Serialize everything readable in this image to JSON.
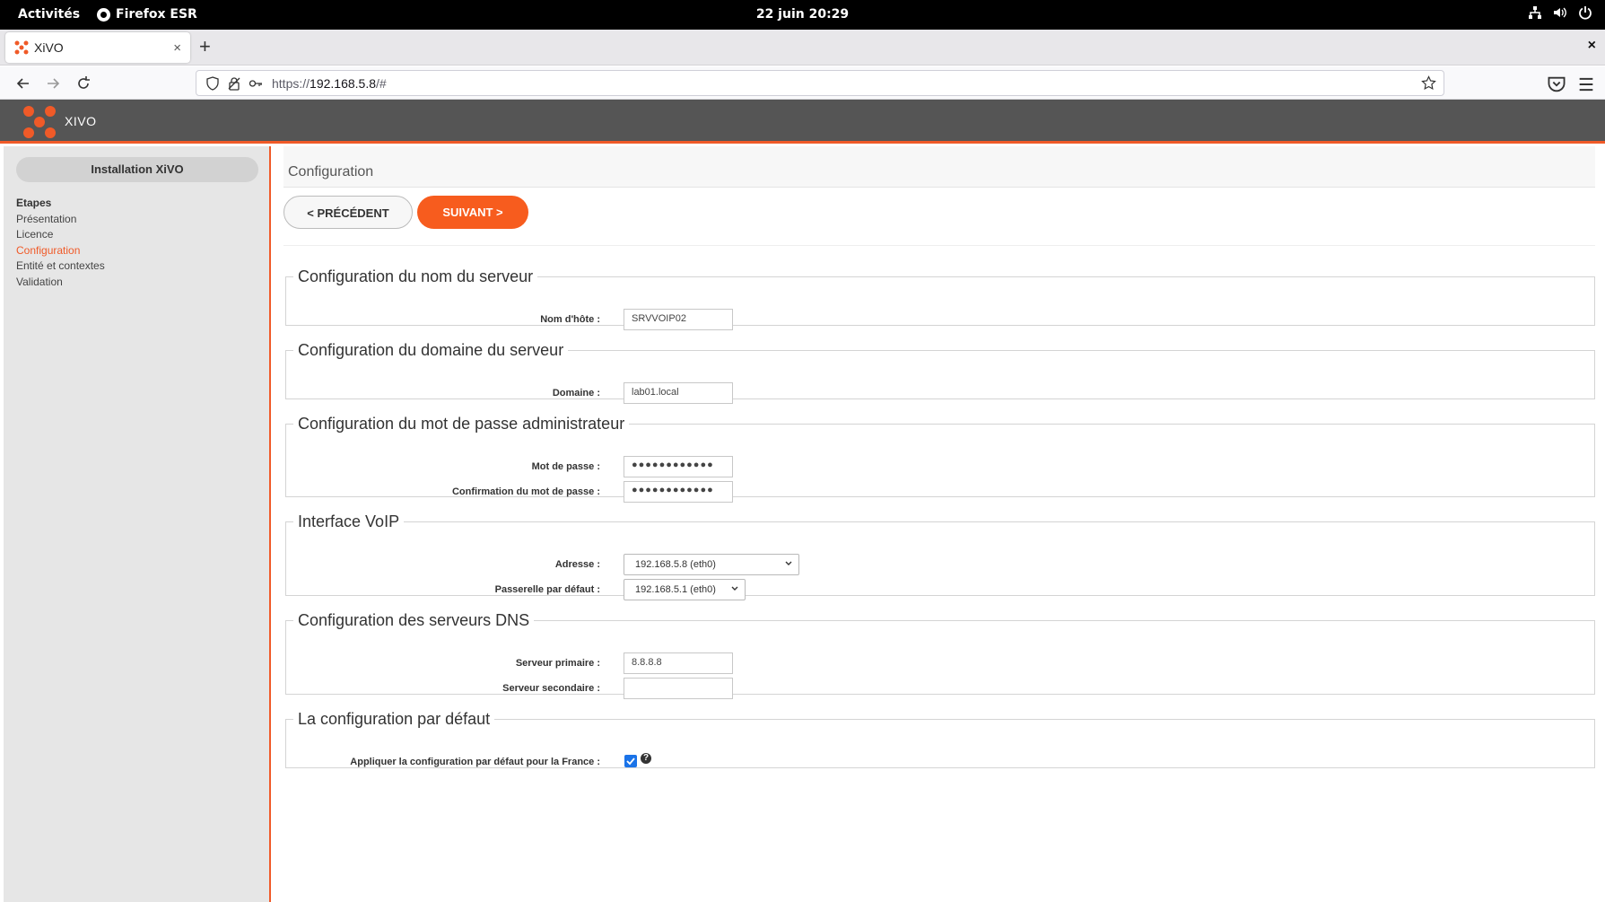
{
  "topbar": {
    "activities": "Activités",
    "app_name": "Firefox ESR",
    "clock": "22 juin  20:29"
  },
  "browser": {
    "tab_title": "XiVO",
    "tab_close": "×",
    "new_tab": "+",
    "window_close": "×",
    "url_prefix": "https://",
    "url_host": "192.168.5.8",
    "url_path": "/#"
  },
  "header": {
    "logo_text": "XIVO"
  },
  "sidebar": {
    "install_label": "Installation XiVO",
    "steps_title": "Etapes",
    "steps": [
      {
        "label": "Présentation",
        "active": false
      },
      {
        "label": "Licence",
        "active": false
      },
      {
        "label": "Configuration",
        "active": true
      },
      {
        "label": "Entité et contextes",
        "active": false
      },
      {
        "label": "Validation",
        "active": false
      }
    ]
  },
  "main": {
    "page_title": "Configuration",
    "prev_label": "< PRÉCÉDENT",
    "next_label": "SUIVANT >"
  },
  "sections": {
    "hostname": {
      "legend": "Configuration du nom du serveur",
      "label": "Nom d'hôte :",
      "value": "SRVVOIP02"
    },
    "domain": {
      "legend": "Configuration du domaine du serveur",
      "label": "Domaine :",
      "value": "lab01.local"
    },
    "password": {
      "legend": "Configuration du mot de passe administrateur",
      "pwd_label": "Mot de passe :",
      "pwd_value": "●●●●●●●●●●●●",
      "confirm_label": "Confirmation du mot de passe :",
      "confirm_value": "●●●●●●●●●●●●"
    },
    "voip": {
      "legend": "Interface VoIP",
      "address_label": "Adresse :",
      "address_value": "192.168.5.8 (eth0)",
      "gateway_label": "Passerelle par défaut :",
      "gateway_value": "192.168.5.1 (eth0)"
    },
    "dns": {
      "legend": "Configuration des serveurs DNS",
      "primary_label": "Serveur primaire :",
      "primary_value": "8.8.8.8",
      "secondary_label": "Serveur secondaire :",
      "secondary_value": ""
    },
    "defaults": {
      "legend": "La configuration par défaut",
      "label": "Appliquer la configuration par défaut pour la France :",
      "checked": true,
      "help": "?"
    }
  },
  "colors": {
    "accent": "#f05a28",
    "button": "#f75c1e",
    "header": "#555555"
  },
  "icons": [
    "firefox-icon",
    "network-icon",
    "volume-icon",
    "power-icon",
    "back-icon",
    "forward-icon",
    "reload-icon",
    "shield-icon",
    "lock-icon",
    "key-icon",
    "star-icon",
    "pocket-icon",
    "menu-icon",
    "xivo-logo"
  ]
}
